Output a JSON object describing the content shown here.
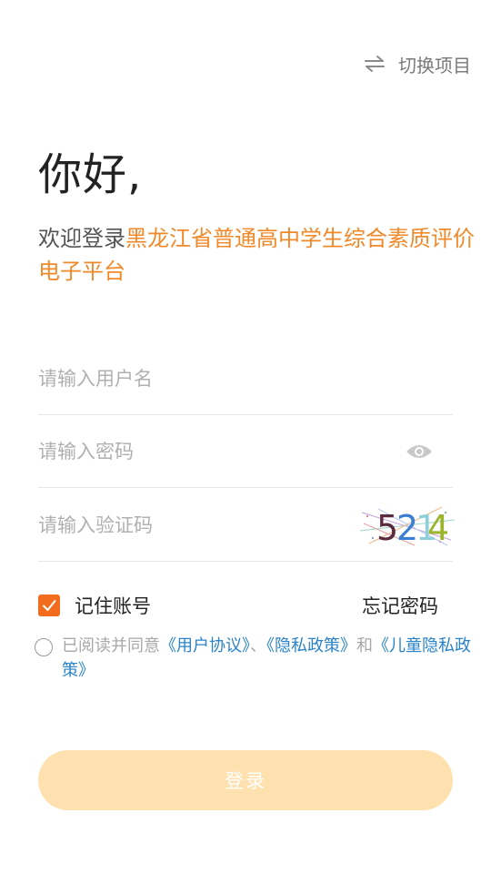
{
  "header": {
    "switch_icon": "swap-arrows-icon",
    "switch_label": "切换项目"
  },
  "greeting": "你好,",
  "welcome": {
    "prefix": "欢迎登录",
    "platform": "黑龙江省普通高中学生综合素质评价电子平台"
  },
  "form": {
    "username_placeholder": "请输入用户名",
    "username_value": "",
    "password_placeholder": "请输入密码",
    "password_value": "",
    "password_toggle_icon": "eye-icon",
    "captcha_placeholder": "请输入验证码",
    "captcha_value": "",
    "captcha_image_text": "5214"
  },
  "options": {
    "remember_checked": true,
    "remember_label": "记住账号",
    "forgot_label": "忘记密码"
  },
  "agreement": {
    "checked": false,
    "prefix": "已阅读并同意",
    "user_agreement": "《用户协议》",
    "sep1": "、",
    "privacy_policy": "《隐私政策》",
    "and": "和",
    "child_privacy": "《儿童隐私政策》"
  },
  "login_label": "登录",
  "colors": {
    "accent_orange": "#f0892a",
    "checkbox_orange": "#f36c1e",
    "link_blue": "#2a83c9",
    "button_disabled": "#ffe1b0"
  }
}
